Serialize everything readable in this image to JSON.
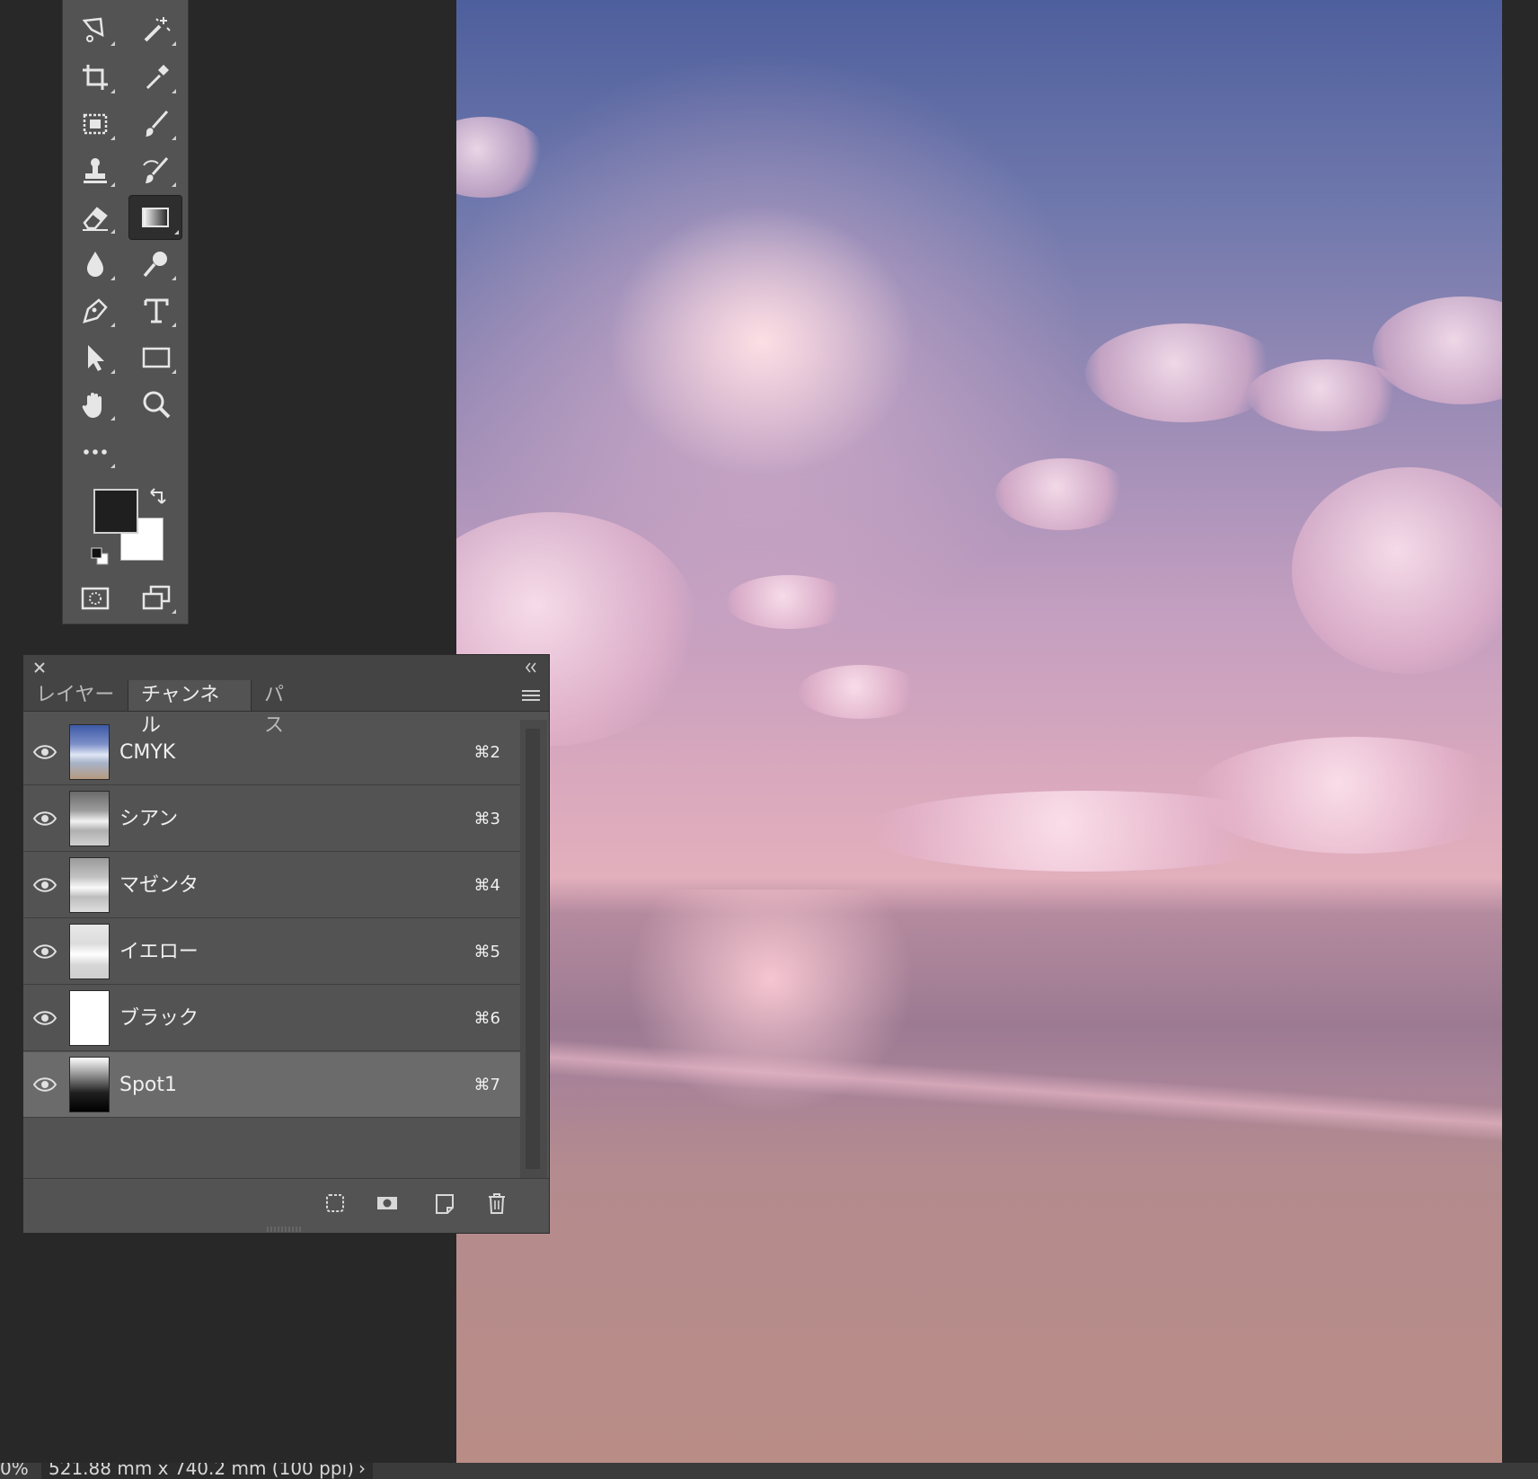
{
  "panel": {
    "tabs": [
      {
        "label": "レイヤー"
      },
      {
        "label": "チャンネル"
      },
      {
        "label": "パス"
      }
    ],
    "channels": [
      {
        "name": "CMYK",
        "shortcut": "⌘2"
      },
      {
        "name": "シアン",
        "shortcut": "⌘3"
      },
      {
        "name": "マゼンタ",
        "shortcut": "⌘4"
      },
      {
        "name": "イエロー",
        "shortcut": "⌘5"
      },
      {
        "name": "ブラック",
        "shortcut": "⌘6"
      },
      {
        "name": "Spot1",
        "shortcut": "⌘7"
      }
    ]
  },
  "status": {
    "zoom": "0%",
    "doc_size": "521.88 mm x 740.2 mm (100 ppi)",
    "arrow": "›"
  },
  "colors": {
    "foreground": "#1f1f1f",
    "background": "#ffffff",
    "ui_panel": "#535353",
    "workspace": "#282828"
  },
  "icons": {
    "toolbar": [
      "lasso-icon",
      "magic-wand-icon",
      "crop-icon",
      "eyedropper-icon",
      "spot-healing-icon",
      "brush-icon",
      "clone-stamp-icon",
      "history-brush-icon",
      "eraser-icon",
      "gradient-icon",
      "blur-icon",
      "dodge-icon",
      "pen-icon",
      "type-icon",
      "path-selection-icon",
      "rectangle-icon",
      "hand-icon",
      "zoom-icon",
      "more-tools-icon"
    ],
    "footer": [
      "load-selection-icon",
      "save-selection-icon",
      "new-channel-icon",
      "trash-icon"
    ]
  }
}
